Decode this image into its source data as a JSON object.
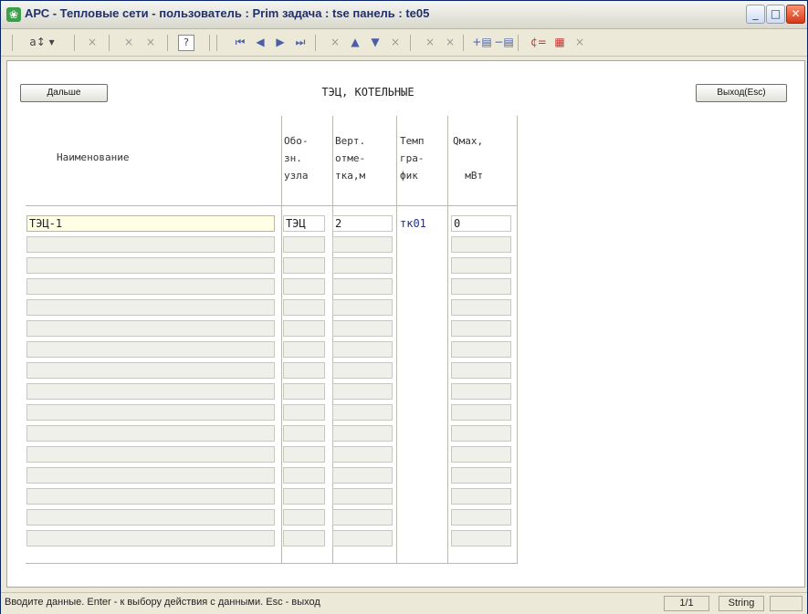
{
  "window": {
    "title": "АРС - Тепловые сети -   пользователь : Prim  задача : tse  панель : te05",
    "app_icon": "app-icon",
    "controls": {
      "minimize": "_",
      "maximize": "□",
      "close": "✕"
    }
  },
  "toolbar": {
    "items": [
      {
        "name": "sort-icon",
        "glyph": "a↕ ▾"
      },
      {
        "name": "delete-icon",
        "glyph": "×"
      },
      {
        "name": "delete2-icon",
        "glyph": "×"
      },
      {
        "name": "delete3-icon",
        "glyph": "×"
      },
      {
        "name": "help-icon",
        "glyph": "?"
      },
      {
        "name": "first-record-icon",
        "glyph": "⏮"
      },
      {
        "name": "prev-record-icon",
        "glyph": "◀"
      },
      {
        "name": "next-record-icon",
        "glyph": "▶"
      },
      {
        "name": "last-record-icon",
        "glyph": "⏭"
      },
      {
        "name": "cancel-icon",
        "glyph": "×"
      },
      {
        "name": "move-up-icon",
        "glyph": "▲"
      },
      {
        "name": "move-down-icon",
        "glyph": "▼"
      },
      {
        "name": "cancel2-icon",
        "glyph": "×"
      },
      {
        "name": "cancel3-icon",
        "glyph": "×"
      },
      {
        "name": "cancel4-icon",
        "glyph": "×"
      },
      {
        "name": "insert-row-icon",
        "glyph": "+▤"
      },
      {
        "name": "delete-row-icon",
        "glyph": "−▤"
      },
      {
        "name": "transfer-icon",
        "glyph": "¢="
      },
      {
        "name": "save-icon",
        "glyph": "▦"
      },
      {
        "name": "cancel5-icon",
        "glyph": "×"
      }
    ]
  },
  "form": {
    "next_button": "Дальше",
    "heading": "ТЭЦ, КОТЕЛЬНЫЕ",
    "exit_button": "Выход(Esc)",
    "columns": [
      {
        "key": "name",
        "label": "Наименование"
      },
      {
        "key": "node",
        "label": "Обо-\nзн.\nузла"
      },
      {
        "key": "elev",
        "label": "Верт.\nотме-\nтка,м"
      },
      {
        "key": "graph",
        "label": "Темп\nгра-\nфик"
      },
      {
        "key": "qmax",
        "label": "Qмах,\n\n  мВт"
      }
    ],
    "rows": [
      {
        "name": "ТЭЦ-1",
        "node": "ТЭЦ",
        "elev": "2",
        "graph": "тк01",
        "qmax": "0"
      }
    ]
  },
  "status": {
    "message": "Вводите данные. Enter - к выбору действия с данными. Esc - выход",
    "page": "1/1",
    "type": "String"
  }
}
